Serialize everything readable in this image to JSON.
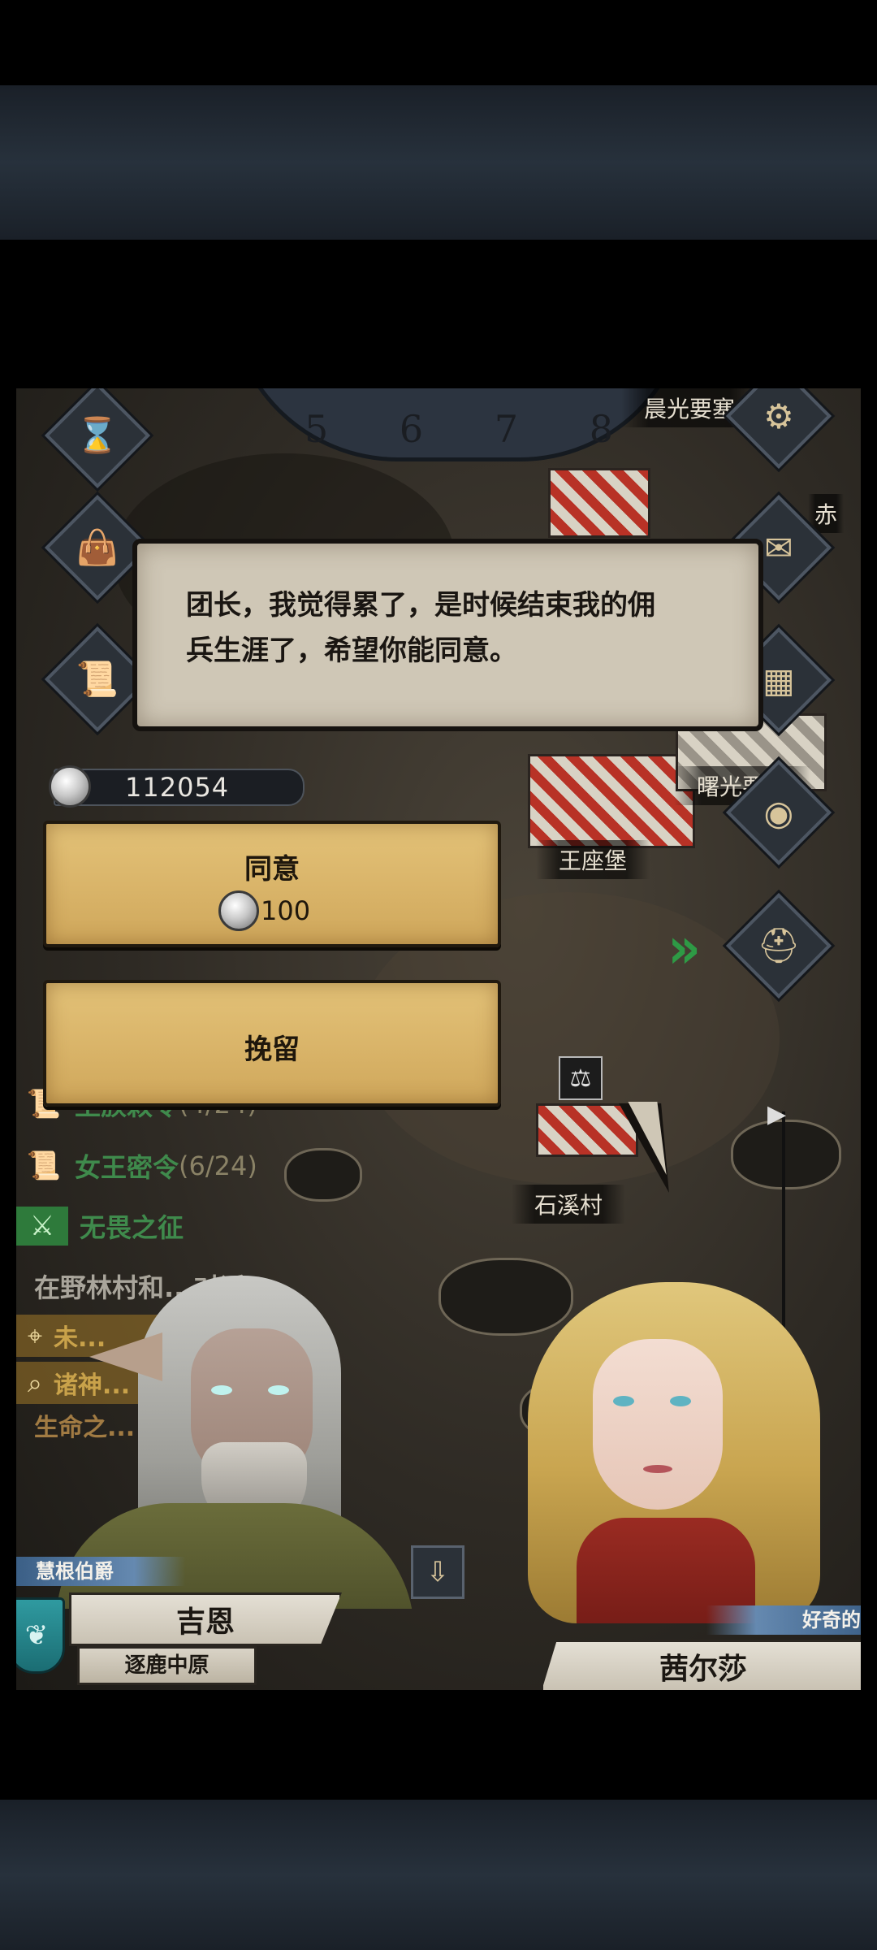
{
  "dialog": {
    "line1": "团长，我觉得累了，是时候结束我的佣",
    "line2": "兵生涯了，希望你能同意。"
  },
  "currency": {
    "silver_total": "112054",
    "icon": "silver-coin-icon"
  },
  "actions": {
    "agree_label": "同意",
    "agree_cost": "100",
    "retain_label": "挽留"
  },
  "map": {
    "timeline_ticks": [
      "5",
      "6",
      "7",
      "8"
    ],
    "labels": {
      "fortress_top": "晨光要塞",
      "fortress_right": "曙光要塞",
      "throne_castle": "王座堡",
      "stone_brook_village": "石溪村",
      "edge_fragment": "赤"
    }
  },
  "quests": [
    {
      "name": "王族敕令",
      "progress": "(4/24)",
      "icon": "scroll-icon"
    },
    {
      "name": "女王密令",
      "progress": "(6/24)",
      "icon": "scroll-icon"
    },
    {
      "name": "无畏之征",
      "progress": "",
      "icon": "sword-icon"
    }
  ],
  "quest_hint": "在野林村和...对话",
  "quest_fragments": [
    "未...",
    "诸神...",
    "生命之..."
  ],
  "speakers": {
    "left": {
      "title": "慧根伯爵",
      "name": "吉恩",
      "faction": "逐鹿中原",
      "emblem": "faction-shield-icon"
    },
    "right": {
      "trait": "好奇的",
      "name": "茜尔莎"
    }
  },
  "side_icons": [
    "hourglass-icon",
    "bag-icon",
    "map-scroll-icon",
    "gear-icon",
    "mail-icon",
    "building-icon",
    "coin-icon",
    "helmet-icon"
  ],
  "colors": {
    "parchment_button": "#dab56a",
    "quest_green": "#3f8a4c",
    "nameplate_blue": "#3b5f86",
    "speech_bubble": "#cfc7b6"
  }
}
